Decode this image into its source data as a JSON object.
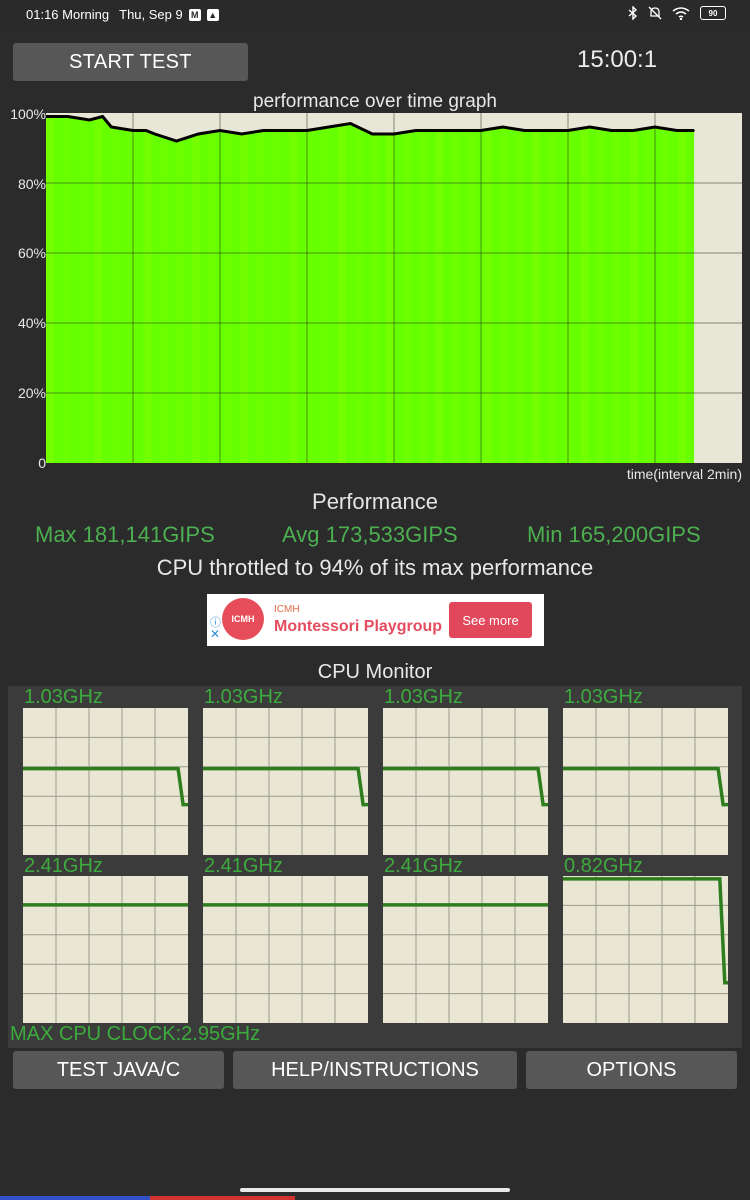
{
  "status": {
    "time": "01:16 Morning",
    "date": "Thu, Sep 9",
    "battery": "90",
    "icons": [
      "gmail-icon",
      "drive-icon",
      "bluetooth-icon",
      "mute-icon",
      "wifi-icon",
      "battery-icon"
    ]
  },
  "toolbar": {
    "start_label": "START TEST",
    "timer": "15:00:1"
  },
  "graph": {
    "title": "performance over time graph",
    "y_ticks": [
      "100%",
      "80%",
      "60%",
      "40%",
      "20%",
      "0"
    ],
    "x_label": "time(interval 2min)",
    "fill_color": "#66ff00",
    "line_color": "#000000"
  },
  "chart_data": {
    "type": "area",
    "title": "performance over time graph",
    "xlabel": "time(interval 2min)",
    "ylabel": "",
    "ylim": [
      0,
      100
    ],
    "x_range_minutes": [
      0,
      16
    ],
    "x": [
      0,
      0.5,
      1,
      1.3,
      1.5,
      2,
      2.3,
      2.5,
      3,
      3.5,
      4,
      4.5,
      5,
      5.5,
      6,
      6.5,
      7,
      7.5,
      8,
      8.5,
      9,
      9.5,
      10,
      10.5,
      11,
      11.5,
      12,
      12.5,
      13,
      13.5,
      14,
      14.5,
      14.9
    ],
    "values": [
      99,
      99,
      98,
      99,
      96,
      95,
      95,
      94,
      92,
      94,
      95,
      94,
      95,
      95,
      95,
      96,
      97,
      94,
      94,
      95,
      95,
      95,
      95,
      96,
      95,
      95,
      95,
      96,
      95,
      95,
      96,
      95,
      95
    ],
    "grid": true
  },
  "performance": {
    "title": "Performance",
    "max": "Max 181,141GIPS",
    "avg": "Avg 173,533GIPS",
    "min": "Min 165,200GIPS",
    "throttle": "CPU throttled to 94% of its max performance"
  },
  "ad": {
    "logo_text": "ICMH",
    "sponsor": "ICMH",
    "title": "Montessori Playgroup",
    "button": "See more",
    "info_icon": "info-icon",
    "close_icon": "close-icon"
  },
  "cpu": {
    "title": "CPU Monitor",
    "cores": [
      {
        "label": "1.03GHz",
        "level": 0.6,
        "drop_at": 0.94,
        "drop_to": 0.35
      },
      {
        "label": "1.03GHz",
        "level": 0.6,
        "drop_at": 0.94,
        "drop_to": 0.35
      },
      {
        "label": "1.03GHz",
        "level": 0.6,
        "drop_at": 0.94,
        "drop_to": 0.35
      },
      {
        "label": "1.03GHz",
        "level": 0.6,
        "drop_at": 0.94,
        "drop_to": 0.35
      },
      {
        "label": "2.41GHz",
        "level": 0.82,
        "drop_at": null,
        "drop_to": null
      },
      {
        "label": "2.41GHz",
        "level": 0.82,
        "drop_at": null,
        "drop_to": null
      },
      {
        "label": "2.41GHz",
        "level": 0.82,
        "drop_at": null,
        "drop_to": null
      },
      {
        "label": "0.82GHz",
        "level": 1.0,
        "drop_at": 0.95,
        "drop_to": 0.28
      }
    ],
    "max_clock": "MAX CPU CLOCK:2.95GHz",
    "line_color": "#2e7d1e"
  },
  "buttons": {
    "java": "TEST JAVA/C",
    "help": "HELP/INSTRUCTIONS",
    "options": "OPTIONS"
  }
}
